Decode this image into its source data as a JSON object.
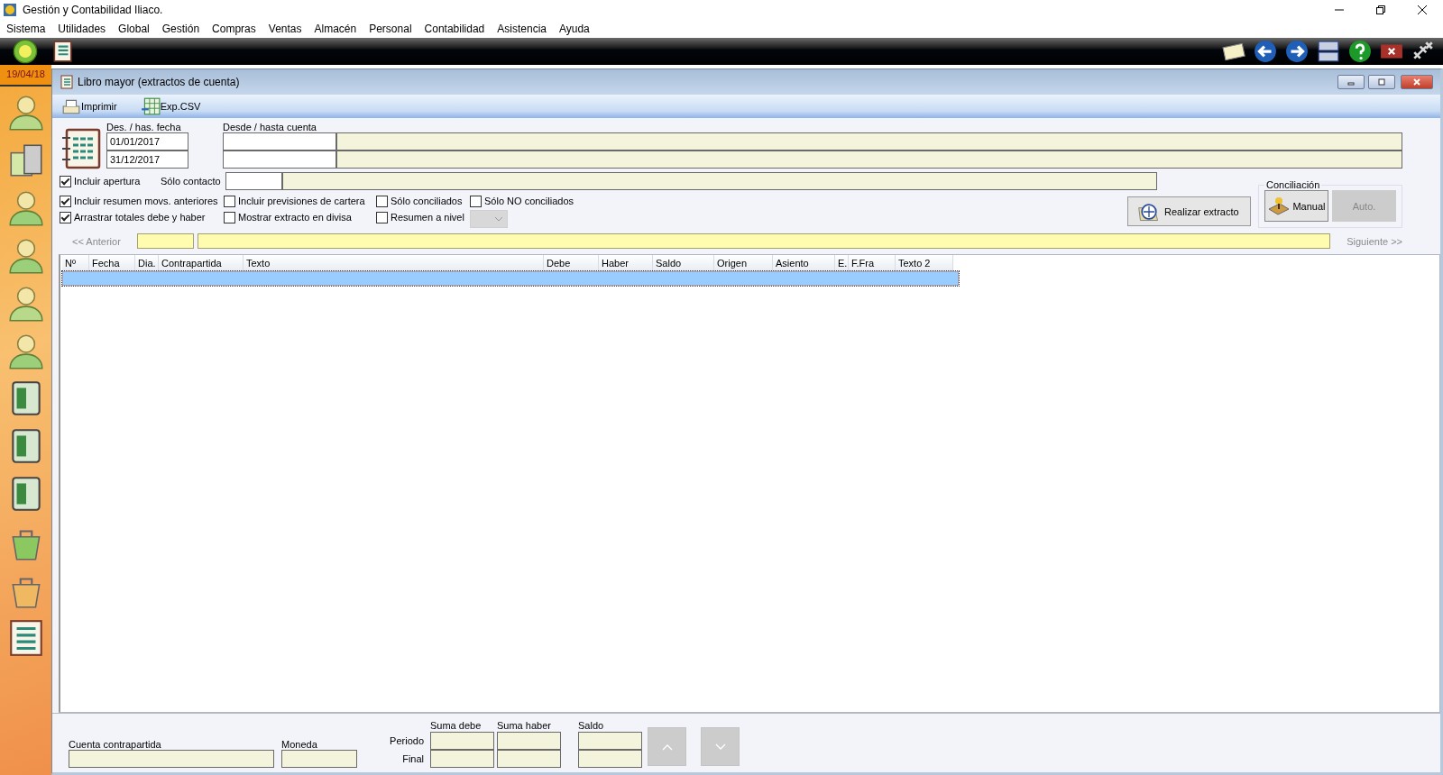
{
  "window": {
    "title": "Gestión y Contabilidad Iliaco."
  },
  "menu": [
    "Sistema",
    "Utilidades",
    "Global",
    "Gestión",
    "Compras",
    "Ventas",
    "Almacén",
    "Personal",
    "Contabilidad",
    "Asistencia",
    "Ayuda"
  ],
  "sidebar": {
    "date": "19/04/18"
  },
  "document": {
    "title": "Libro mayor (extractos de cuenta)",
    "toolbar": [
      {
        "kind": "print",
        "label": "Imprimir"
      },
      {
        "kind": "csv",
        "label": "Exp.CSV"
      }
    ],
    "dates": {
      "label": "Des. / has. fecha",
      "from": "01/01/2017",
      "to": "31/12/2017"
    },
    "accounts": {
      "label": "Desde / hasta cuenta"
    },
    "contact": {
      "label": "Sólo contacto"
    },
    "options": [
      {
        "label": "Incluir apertura",
        "checked": true
      },
      {
        "label": "Incluir resumen movs. anteriores",
        "checked": true
      },
      {
        "label": "Incluir previsiones de cartera",
        "checked": false
      },
      {
        "label": "Sólo conciliados",
        "checked": false
      },
      {
        "label": "Sólo NO conciliados",
        "checked": false
      },
      {
        "label": "Arrastrar totales debe y haber",
        "checked": true
      },
      {
        "label": "Mostrar extracto en divisa",
        "checked": false
      },
      {
        "label": "Resumen a nivel",
        "checked": false
      }
    ],
    "level_select": {
      "disabled": true
    },
    "run_button": "Realizar extracto",
    "reconciliation": {
      "title": "Conciliación",
      "buttons": [
        {
          "label": "Manual",
          "disabled": false
        },
        {
          "label": "Auto.",
          "disabled": true
        }
      ]
    },
    "nav": {
      "previous": "<< Anterior",
      "next": "Siguiente >>",
      "disabled": true
    },
    "table": {
      "columns": [
        "Nº",
        "Fecha",
        "Dia.",
        "Contrapartida",
        "Texto",
        "Debe",
        "Haber",
        "Saldo",
        "Origen",
        "Asiento",
        "E.",
        "F.Fra",
        "Texto 2"
      ],
      "rows": [
        {
          "selected": true
        }
      ]
    },
    "footer": {
      "counter_account": "Cuenta contrapartida",
      "currency": "Moneda",
      "sum_debit": "Suma debe",
      "sum_credit": "Suma haber",
      "balance": "Saldo",
      "period": "Periodo",
      "final": "Final"
    }
  }
}
